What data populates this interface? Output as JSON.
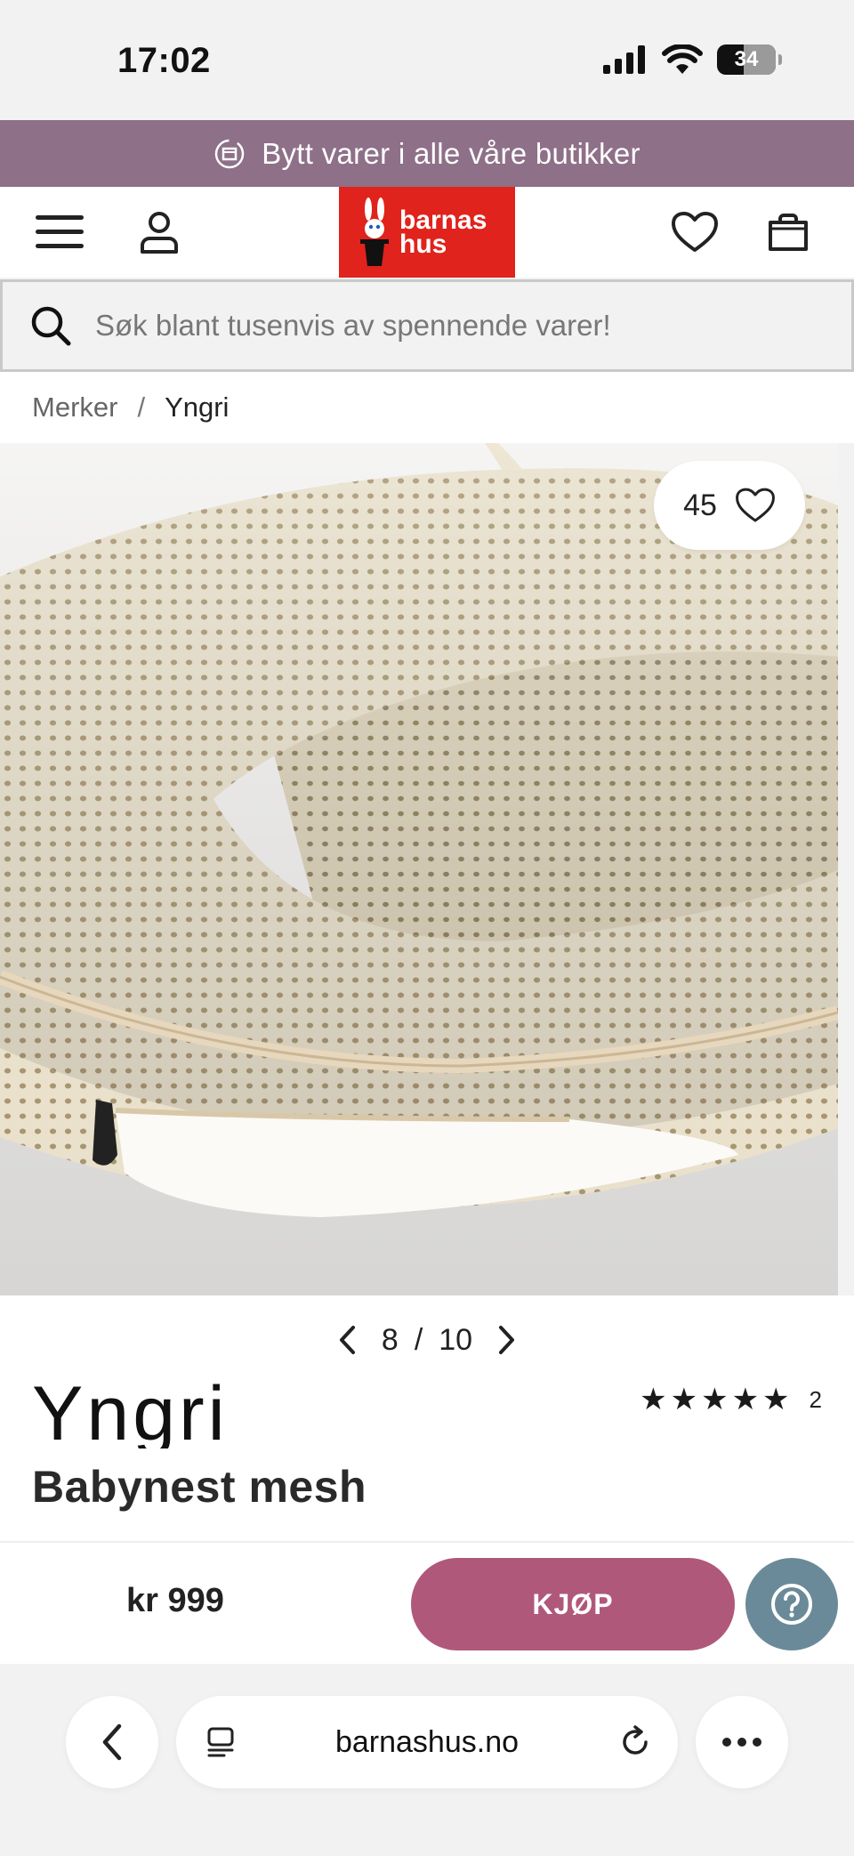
{
  "status_bar": {
    "time": "17:02",
    "battery": "34"
  },
  "promo": {
    "text": "Bytt varer i alle våre butikker"
  },
  "header": {
    "logo_line1": "barnas",
    "logo_line2": "hus"
  },
  "search": {
    "placeholder": "Søk blant tusenvis av spennende varer!"
  },
  "breadcrumb": {
    "parent": "Merker",
    "separator": "/",
    "current": "Yngri"
  },
  "gallery": {
    "likes": "45",
    "current": "8",
    "separator": "/",
    "total": "10"
  },
  "product": {
    "brand": "Yngri",
    "title": "Babynest mesh",
    "rating": {
      "stars": 5,
      "count": "2"
    }
  },
  "buy_bar": {
    "price": "kr 999",
    "buy_label": "KJØP"
  },
  "browser": {
    "url": "barnashus.no"
  },
  "colors": {
    "promo": "#8e7088",
    "logo": "#e0231c",
    "buy": "#b0587a",
    "help": "#6b8a99"
  }
}
